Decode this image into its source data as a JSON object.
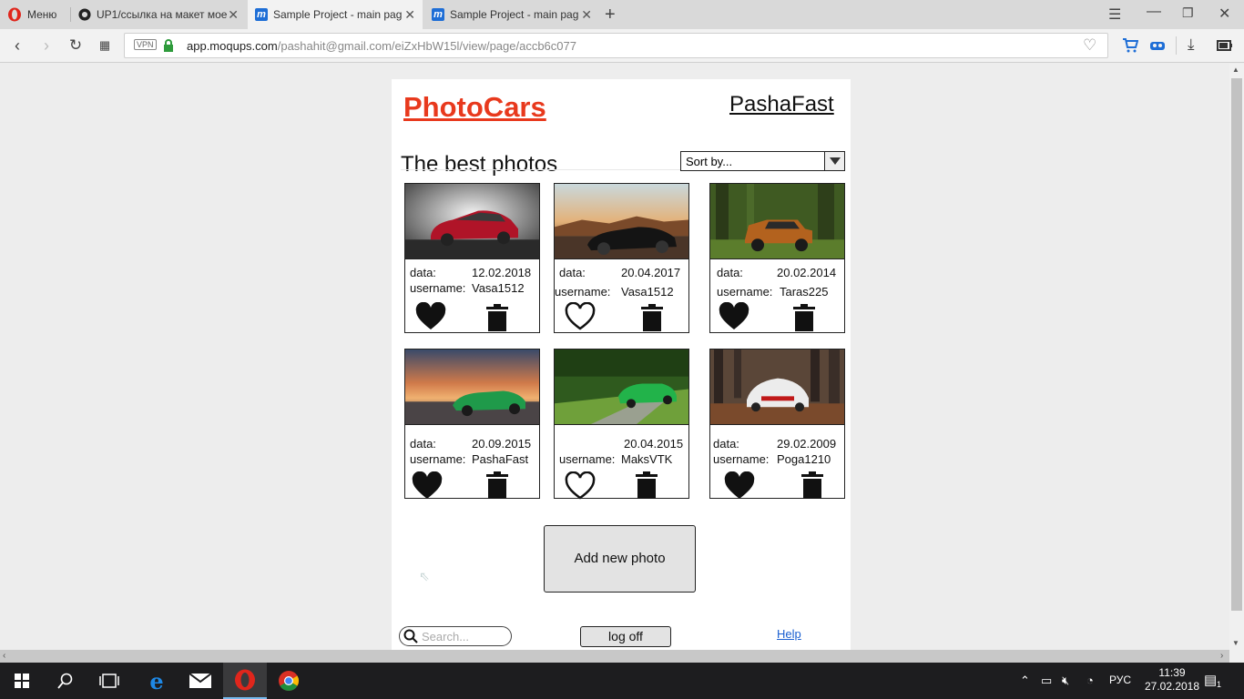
{
  "browser": {
    "menu_label": "Меню",
    "tabs": [
      {
        "label": "UP1/ссылка на макет мое"
      },
      {
        "label": "Sample Project - main pag"
      },
      {
        "label": "Sample Project - main pag"
      }
    ],
    "vpn_label": "VPN",
    "url_host": "app.moqups.com",
    "url_path": "/pashahit@gmail.com/eiZxHbW15l/view/page/accb6c077"
  },
  "page": {
    "brand": "PhotoCars",
    "username": "PashaFast",
    "heading": "The best photos",
    "sort_placeholder": "Sort by...",
    "data_label": "data:",
    "username_label": "username:",
    "cards": [
      {
        "date": "12.02.2018",
        "user": "Vasa1512",
        "liked": true
      },
      {
        "date": "20.04.2017",
        "user": "Vasa1512",
        "liked": false
      },
      {
        "date": "20.02.2014",
        "user": "Taras225",
        "liked": true
      },
      {
        "date": "20.09.2015",
        "user": "PashaFast",
        "liked": true
      },
      {
        "date": "20.04.2015",
        "user": "MaksVTK",
        "liked": false
      },
      {
        "date": "29.02.2009",
        "user": "Poga1210",
        "liked": true
      }
    ],
    "add_button": "Add new photo",
    "search_placeholder": "Search...",
    "logoff_button": "log off",
    "help_link": "Help"
  },
  "taskbar": {
    "language": "РУС",
    "time": "11:39",
    "date": "27.02.2018",
    "notification_count": "1"
  },
  "colors": {
    "brand": "#e8391d",
    "link": "#1a5fd0",
    "taskbar": "#1d1d1f"
  }
}
